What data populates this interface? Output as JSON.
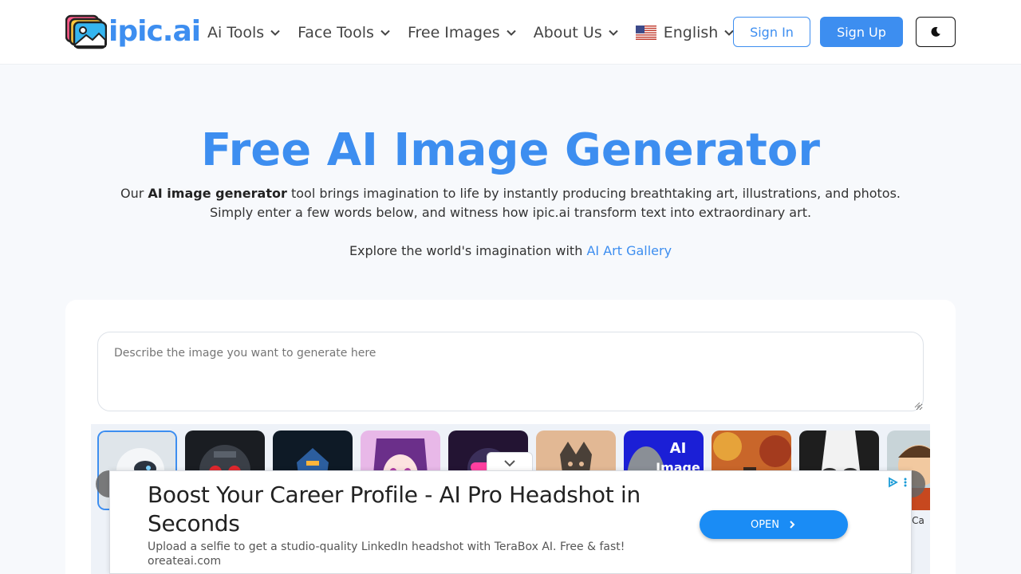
{
  "brand": {
    "name": "ipic.ai",
    "accent": "#3d8ef0"
  },
  "nav": {
    "items": [
      {
        "label": "Ai Tools"
      },
      {
        "label": "Face Tools"
      },
      {
        "label": "Free Images"
      },
      {
        "label": "About Us"
      }
    ],
    "language": "English",
    "language_flag": "us-flag-icon"
  },
  "auth": {
    "sign_in": "Sign In",
    "sign_up": "Sign Up",
    "theme_icon": "moon-icon"
  },
  "hero": {
    "title": "Free AI Image Generator",
    "desc_prefix": "Our ",
    "desc_bold": "AI image generator",
    "desc_line1_rest": " tool brings imagination to life by instantly producing breathtaking art, illustrations, and photos.",
    "desc_line2": "Simply enter a few words below, and witness how ipic.ai transform text into extraordinary art.",
    "explore_text": "Explore the world's imagination with ",
    "explore_link": "AI Art Gallery"
  },
  "generator": {
    "prompt_placeholder": "Describe the image you want to generate here",
    "styles": [
      {
        "name": "robot-style",
        "selected": true
      },
      {
        "name": "mech-helmet-style",
        "selected": false
      },
      {
        "name": "armored-robot-style",
        "selected": false
      },
      {
        "name": "anime-girl-style",
        "selected": false
      },
      {
        "name": "neon-cyberpunk-style",
        "selected": false
      },
      {
        "name": "wolf-tattoo-style",
        "selected": false
      },
      {
        "name": "ai-image-text-style",
        "thumb_text": "AI Image",
        "selected": false
      },
      {
        "name": "autumn-painting-style",
        "selected": false
      },
      {
        "name": "sketch-face-style",
        "selected": false
      },
      {
        "name": "cartoon-character-style",
        "selected": false
      }
    ],
    "partial_caption": "l Ca"
  },
  "ad": {
    "title": "Boost Your Career Profile - AI Pro Headshot in Seconds",
    "description": "Upload a selfie to get a studio-quality LinkedIn headshot with TeraBox AI. Free & fast!",
    "domain": "oreateai.com",
    "cta": "OPEN"
  }
}
